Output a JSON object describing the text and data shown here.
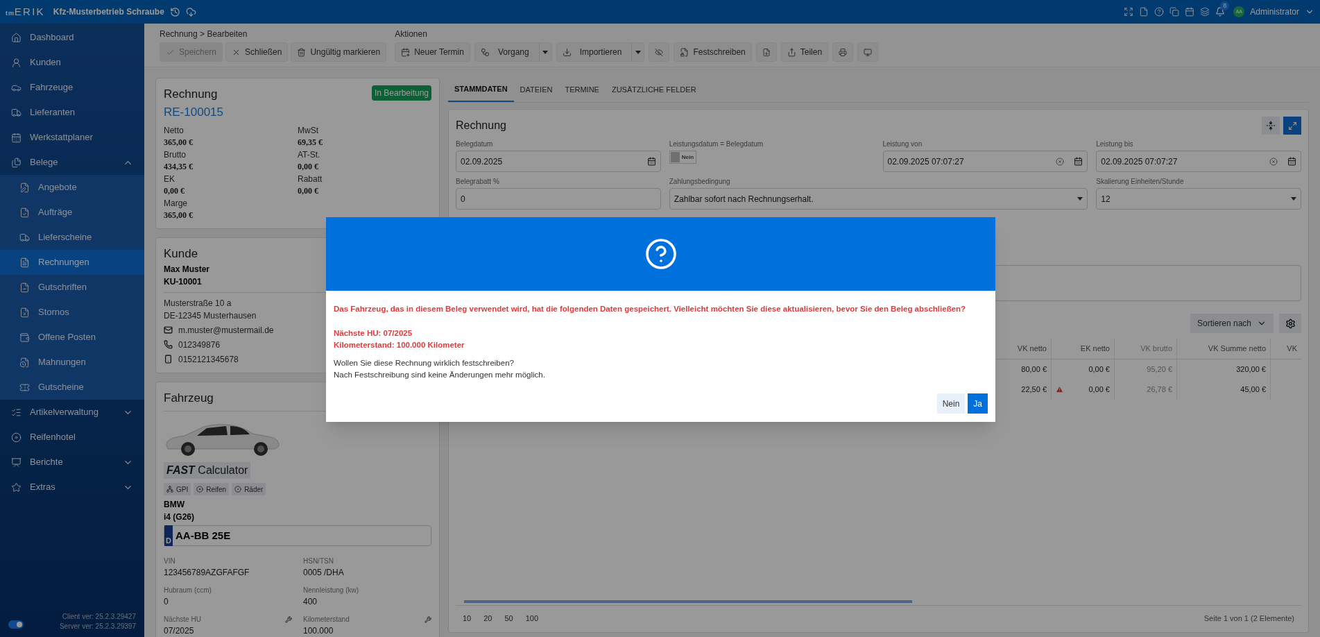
{
  "topbar": {
    "logo_prefix": "tm",
    "logo": "ERIK",
    "company": "Kfz-Musterbetrieb Schraube",
    "notifications": "8",
    "user_initials": "AA",
    "user": "Administrator"
  },
  "sidebar": {
    "items": [
      {
        "label": "Dashboard",
        "selected": false
      },
      {
        "label": "Kunden",
        "selected": false
      },
      {
        "label": "Fahrzeuge",
        "selected": false
      },
      {
        "label": "Lieferanten",
        "selected": false
      },
      {
        "label": "Werkstattplaner",
        "selected": false
      },
      {
        "label": "Belege",
        "selected": false,
        "expanded": true,
        "children": [
          {
            "label": "Angebote",
            "selected": false
          },
          {
            "label": "Aufträge",
            "selected": false
          },
          {
            "label": "Lieferscheine",
            "selected": false
          },
          {
            "label": "Rechnungen",
            "selected": true
          },
          {
            "label": "Gutschriften",
            "selected": false
          },
          {
            "label": "Stornos",
            "selected": false
          },
          {
            "label": "Offene Posten",
            "selected": false
          },
          {
            "label": "Mahnungen",
            "selected": false
          },
          {
            "label": "Gutscheine",
            "selected": false
          }
        ]
      },
      {
        "label": "Artikelverwaltung",
        "selected": false,
        "expanded": false
      },
      {
        "label": "Reifenhotel",
        "selected": false
      },
      {
        "label": "Berichte",
        "selected": false,
        "expanded": false
      },
      {
        "label": "Extras",
        "selected": false,
        "expanded": false
      }
    ],
    "toggle_on": true,
    "client_version": "Client ver: 25.2.3.29427",
    "server_version": "Server ver: 25.2.3.29397"
  },
  "toolbar": {
    "breadcrumb": "Rechnung > Bearbeiten",
    "buttons": [
      {
        "label": "Speichern",
        "disabled": true
      },
      {
        "label": "Schließen",
        "disabled": false
      },
      {
        "label": "Ungültig markieren",
        "disabled": false
      }
    ],
    "actions_title": "Aktionen",
    "actions": [
      {
        "kind": "button",
        "label": "Neuer Termin"
      },
      {
        "kind": "split",
        "label": "Vorgang"
      },
      {
        "kind": "split",
        "label": "Importieren"
      },
      {
        "kind": "icon"
      },
      {
        "kind": "button",
        "label": "Festschreiben"
      },
      {
        "kind": "icon"
      },
      {
        "kind": "button",
        "label": "Teilen"
      },
      {
        "kind": "icon"
      },
      {
        "kind": "icon"
      }
    ]
  },
  "invoice_card": {
    "title": "Rechnung",
    "number": "RE-100015",
    "status": "In Bearbeitung",
    "stats": [
      {
        "label": "Netto",
        "value": "365,00 €"
      },
      {
        "label": "MwSt",
        "value": "69,35 €"
      },
      {
        "label": "Brutto",
        "value": "434,35 €"
      },
      {
        "label": "AT-St.",
        "value": "0,00 €"
      },
      {
        "label": "EK",
        "value": "0,00 €"
      },
      {
        "label": "Rabatt",
        "value": "0,00 €"
      },
      {
        "label": "Marge",
        "value": "365,00 €"
      }
    ]
  },
  "customer_card": {
    "title": "Kunde",
    "name": "Max Muster",
    "number": "KU-10001",
    "street": "Musterstraße 10 a",
    "city": "DE-12345 Musterhausen",
    "email": "m.muster@mustermail.de",
    "phone": "012349876",
    "mobile": "0152121345678"
  },
  "vehicle_card": {
    "title": "Fahrzeug",
    "calculator_bold": "FAST",
    "calculator": "Calculator",
    "chips": [
      "GPI",
      "Reifen",
      "Räder"
    ],
    "make": "BMW",
    "model": "i4 (G26)",
    "plate_country": "D",
    "plate": "AA-BB 25E",
    "fields": [
      {
        "label": "VIN",
        "value": "123456789AZGFAFGF",
        "editable": false
      },
      {
        "label": "HSN/TSN",
        "value": "0005 /DHA",
        "editable": false
      },
      {
        "label": "Hubraum (ccm)",
        "value": "0",
        "editable": false
      },
      {
        "label": "Nennleistung (kw)",
        "value": "400",
        "editable": false
      },
      {
        "label": "Nächste HU",
        "value": "07/2025",
        "editable": true
      },
      {
        "label": "Kilometerstand",
        "value": "100.000",
        "editable": true
      }
    ]
  },
  "tabs": [
    {
      "label": "STAMMDATEN",
      "selected": true
    },
    {
      "label": "DATEIEN",
      "selected": false
    },
    {
      "label": "TERMINE",
      "selected": false
    },
    {
      "label": "ZUSÄTZLICHE FELDER",
      "selected": false
    }
  ],
  "form": {
    "title": "Rechnung",
    "fields": [
      {
        "kind": "date",
        "label": "Belegdatum",
        "value": "02.09.2025"
      },
      {
        "kind": "toggle",
        "label": "Leistungsdatum = Belegdatum",
        "value": "Nein",
        "on": false
      },
      {
        "kind": "datetime",
        "label": "Leistung von",
        "value": "02.09.2025 07:07:27"
      },
      {
        "kind": "datetime",
        "label": "Leistung bis",
        "value": "02.09.2025 07:07:27"
      },
      {
        "kind": "text",
        "label": "Belegrabatt %",
        "value": "0"
      },
      {
        "kind": "select",
        "label": "Zahlungsbedingung",
        "value": "Zahlbar sofort nach Rechnungserhalt."
      },
      {
        "kind": "select",
        "label": "Skalierung Einheiten/Stunde",
        "value": "12"
      }
    ]
  },
  "table": {
    "sort_label": "Sortieren nach",
    "columns": [
      {
        "label": "VK netto",
        "disabled": false
      },
      {
        "label": "EK netto",
        "disabled": false
      },
      {
        "label": "VK brutto",
        "disabled": true
      },
      {
        "label": "VK Summe netto",
        "disabled": false
      },
      {
        "label": "VK",
        "disabled": false
      }
    ],
    "rows": [
      {
        "warning": false,
        "cells": [
          "80,00 €",
          "0,00 €",
          "95,20 €",
          "320,00 €"
        ]
      },
      {
        "warning": true,
        "cells": [
          "22,50 €",
          "0,00 €",
          "26,78 €",
          "45,00 €"
        ]
      }
    ],
    "page_sizes": [
      "10",
      "20",
      "50",
      "100"
    ],
    "page_info": "Seite 1 von 1 (2 Elemente)"
  },
  "dialog": {
    "warning": "Das Fahrzeug, das in diesem Beleg verwendet wird, hat die folgenden Daten gespeichert. Vielleicht möchten Sie diese aktualisieren, bevor Sie den Beleg abschließen?",
    "details": [
      "Nächste HU: 07/2025",
      "Kilometerstand: 100.000 Kilometer"
    ],
    "question": [
      "Wollen Sie diese Rechnung wirklich festschreiben?",
      "Nach Festschreibung sind keine Änderungen mehr möglich."
    ],
    "buttons": [
      {
        "label": "Nein",
        "primary": false
      },
      {
        "label": "Ja",
        "primary": true
      }
    ]
  }
}
